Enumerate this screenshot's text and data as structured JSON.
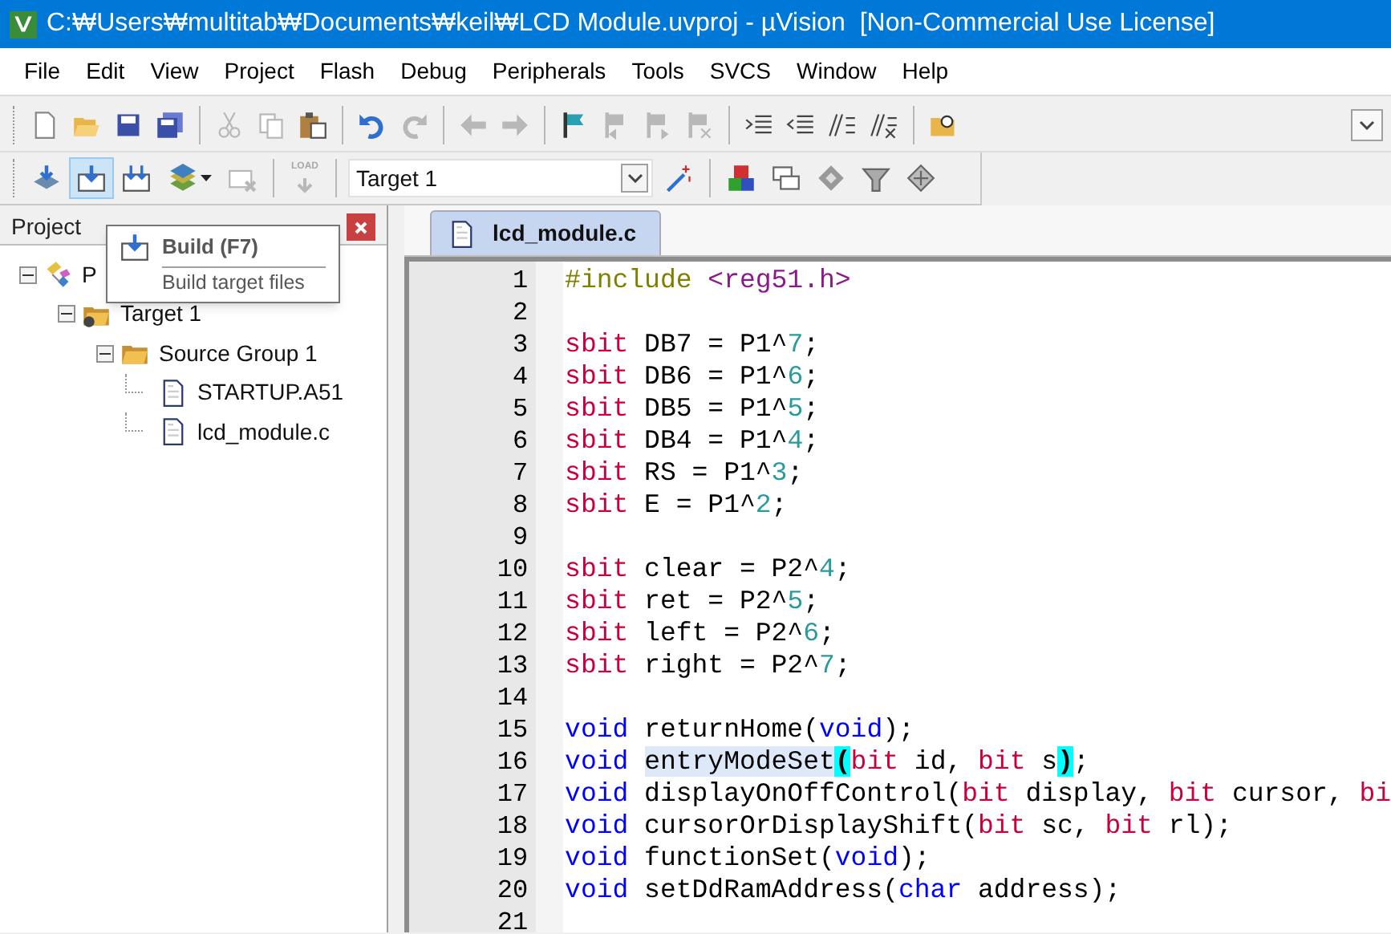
{
  "window": {
    "title": "C:₩Users₩multitab₩Documents₩keil₩LCD Module.uvproj - µVision  [Non-Commercial Use License]"
  },
  "menu": [
    "File",
    "Edit",
    "View",
    "Project",
    "Flash",
    "Debug",
    "Peripherals",
    "Tools",
    "SVCS",
    "Window",
    "Help"
  ],
  "toolbar_1": [
    {
      "kind": "button",
      "disabled": false
    },
    {
      "kind": "button",
      "disabled": false
    },
    {
      "kind": "button",
      "disabled": false
    },
    {
      "kind": "button",
      "disabled": false
    },
    {
      "kind": "separator"
    },
    {
      "kind": "button",
      "disabled": true
    },
    {
      "kind": "button",
      "disabled": true
    },
    {
      "kind": "button",
      "disabled": false
    },
    {
      "kind": "separator"
    },
    {
      "kind": "button",
      "disabled": false
    },
    {
      "kind": "button",
      "disabled": true
    },
    {
      "kind": "separator"
    },
    {
      "kind": "button",
      "disabled": true
    },
    {
      "kind": "button",
      "disabled": true
    },
    {
      "kind": "separator"
    },
    {
      "kind": "button",
      "disabled": false
    },
    {
      "kind": "button",
      "disabled": true
    },
    {
      "kind": "button",
      "disabled": true
    },
    {
      "kind": "button",
      "disabled": true
    },
    {
      "kind": "separator"
    },
    {
      "kind": "button",
      "disabled": false
    },
    {
      "kind": "button",
      "disabled": false
    },
    {
      "kind": "button",
      "disabled": false
    },
    {
      "kind": "button",
      "disabled": false
    },
    {
      "kind": "separator"
    },
    {
      "kind": "button",
      "disabled": false
    },
    {
      "kind": "overflow"
    }
  ],
  "toolbar_2": [
    {
      "kind": "button",
      "disabled": false,
      "hovered": false
    },
    {
      "kind": "button",
      "disabled": false,
      "hovered": true
    },
    {
      "kind": "button",
      "disabled": false,
      "hovered": false
    },
    {
      "kind": "split",
      "disabled": false,
      "hovered": false
    },
    {
      "kind": "button",
      "disabled": true,
      "hovered": false
    },
    {
      "kind": "separator"
    },
    {
      "kind": "button",
      "disabled": true,
      "hovered": false,
      "label": "LOAD"
    },
    {
      "kind": "separator"
    },
    {
      "kind": "select",
      "value": "Target 1"
    },
    {
      "kind": "button",
      "disabled": false,
      "hovered": false
    },
    {
      "kind": "separator"
    },
    {
      "kind": "button",
      "disabled": false,
      "hovered": false
    },
    {
      "kind": "button",
      "disabled": false,
      "hovered": false
    },
    {
      "kind": "button",
      "disabled": false,
      "hovered": false
    },
    {
      "kind": "button",
      "disabled": false,
      "hovered": false
    },
    {
      "kind": "button",
      "disabled": false,
      "hovered": false
    }
  ],
  "project_panel": {
    "title": "Project",
    "tree": [
      {
        "label": "P",
        "kind": "project",
        "expanded": true,
        "children": [
          {
            "label": "Target 1",
            "kind": "target",
            "expanded": true,
            "children": [
              {
                "label": "Source Group 1",
                "kind": "group",
                "expanded": true,
                "children": [
                  {
                    "label": "STARTUP.A51",
                    "kind": "file"
                  },
                  {
                    "label": "lcd_module.c",
                    "kind": "file"
                  }
                ]
              }
            ]
          }
        ]
      }
    ]
  },
  "tooltip": {
    "title": "Build (F7)",
    "description": "Build target files"
  },
  "editor": {
    "tabs": [
      {
        "label": "lcd_module.c",
        "selected": true
      }
    ],
    "lines": [
      {
        "number": "1",
        "tokens": [
          {
            "text": "#include",
            "kind": "preprocessor"
          },
          {
            "text": " <reg51.h>",
            "kind": "header"
          }
        ]
      },
      {
        "number": "2"
      },
      {
        "number": "3",
        "tokens": [
          {
            "text": "sbit",
            "kind": "keyword"
          },
          {
            "text": " DB7 = P1^",
            "kind": "plain"
          },
          {
            "text": "7",
            "kind": "number"
          },
          {
            "text": ";",
            "kind": "plain"
          }
        ]
      },
      {
        "number": "4",
        "tokens": [
          {
            "text": "sbit",
            "kind": "keyword"
          },
          {
            "text": " DB6 = P1^",
            "kind": "plain"
          },
          {
            "text": "6",
            "kind": "number"
          },
          {
            "text": ";",
            "kind": "plain"
          }
        ]
      },
      {
        "number": "5",
        "tokens": [
          {
            "text": "sbit",
            "kind": "keyword"
          },
          {
            "text": " DB5 = P1^",
            "kind": "plain"
          },
          {
            "text": "5",
            "kind": "number"
          },
          {
            "text": ";",
            "kind": "plain"
          }
        ]
      },
      {
        "number": "6",
        "tokens": [
          {
            "text": "sbit",
            "kind": "keyword"
          },
          {
            "text": " DB4 = P1^",
            "kind": "plain"
          },
          {
            "text": "4",
            "kind": "number"
          },
          {
            "text": ";",
            "kind": "plain"
          }
        ]
      },
      {
        "number": "7",
        "tokens": [
          {
            "text": "sbit",
            "kind": "keyword"
          },
          {
            "text": " RS = P1^",
            "kind": "plain"
          },
          {
            "text": "3",
            "kind": "number"
          },
          {
            "text": ";",
            "kind": "plain"
          }
        ]
      },
      {
        "number": "8",
        "tokens": [
          {
            "text": "sbit",
            "kind": "keyword"
          },
          {
            "text": " E = P1^",
            "kind": "plain"
          },
          {
            "text": "2",
            "kind": "number"
          },
          {
            "text": ";",
            "kind": "plain"
          }
        ]
      },
      {
        "number": "9"
      },
      {
        "number": "10",
        "tokens": [
          {
            "text": "sbit",
            "kind": "keyword"
          },
          {
            "text": " clear = P2^",
            "kind": "plain"
          },
          {
            "text": "4",
            "kind": "number"
          },
          {
            "text": ";",
            "kind": "plain"
          }
        ]
      },
      {
        "number": "11",
        "tokens": [
          {
            "text": "sbit",
            "kind": "keyword"
          },
          {
            "text": " ret = P2^",
            "kind": "plain"
          },
          {
            "text": "5",
            "kind": "number"
          },
          {
            "text": ";",
            "kind": "plain"
          }
        ]
      },
      {
        "number": "12",
        "tokens": [
          {
            "text": "sbit",
            "kind": "keyword"
          },
          {
            "text": " left = P2^",
            "kind": "plain"
          },
          {
            "text": "6",
            "kind": "number"
          },
          {
            "text": ";",
            "kind": "plain"
          }
        ]
      },
      {
        "number": "13",
        "tokens": [
          {
            "text": "sbit",
            "kind": "keyword"
          },
          {
            "text": " right = P2^",
            "kind": "plain"
          },
          {
            "text": "7",
            "kind": "number"
          },
          {
            "text": ";",
            "kind": "plain"
          }
        ]
      },
      {
        "number": "14"
      },
      {
        "number": "15",
        "tokens": [
          {
            "text": "void",
            "kind": "type"
          },
          {
            "text": " returnHome(",
            "kind": "plain"
          },
          {
            "text": "void",
            "kind": "type"
          },
          {
            "text": ");",
            "kind": "plain"
          }
        ]
      },
      {
        "number": "16",
        "tokens": [
          {
            "text": "void ",
            "kind": "type"
          },
          {
            "text": "entryModeSet",
            "kind": "selection"
          },
          {
            "text": "(",
            "kind": "brace-match"
          },
          {
            "text": "bit",
            "kind": "keyword"
          },
          {
            "text": " id, ",
            "kind": "plain"
          },
          {
            "text": "bit",
            "kind": "keyword"
          },
          {
            "text": " s",
            "kind": "plain"
          },
          {
            "text": ")",
            "kind": "brace-match"
          },
          {
            "text": ";",
            "kind": "plain"
          }
        ]
      },
      {
        "number": "17",
        "tokens": [
          {
            "text": "void",
            "kind": "type"
          },
          {
            "text": " displayOnOffControl(",
            "kind": "plain"
          },
          {
            "text": "bit",
            "kind": "keyword"
          },
          {
            "text": " display, ",
            "kind": "plain"
          },
          {
            "text": "bit",
            "kind": "keyword"
          },
          {
            "text": " cursor, ",
            "kind": "plain"
          },
          {
            "text": "bi",
            "kind": "keyword"
          }
        ]
      },
      {
        "number": "18",
        "tokens": [
          {
            "text": "void",
            "kind": "type"
          },
          {
            "text": " cursorOrDisplayShift(",
            "kind": "plain"
          },
          {
            "text": "bit",
            "kind": "keyword"
          },
          {
            "text": " sc, ",
            "kind": "plain"
          },
          {
            "text": "bit",
            "kind": "keyword"
          },
          {
            "text": " rl);",
            "kind": "plain"
          }
        ]
      },
      {
        "number": "19",
        "tokens": [
          {
            "text": "void",
            "kind": "type"
          },
          {
            "text": " functionSet(",
            "kind": "plain"
          },
          {
            "text": "void",
            "kind": "type"
          },
          {
            "text": ");",
            "kind": "plain"
          }
        ]
      },
      {
        "number": "20",
        "tokens": [
          {
            "text": "void",
            "kind": "type"
          },
          {
            "text": " setDdRamAddress(",
            "kind": "plain"
          },
          {
            "text": "char",
            "kind": "type"
          },
          {
            "text": " address);",
            "kind": "plain"
          }
        ]
      },
      {
        "number": "21"
      }
    ]
  }
}
